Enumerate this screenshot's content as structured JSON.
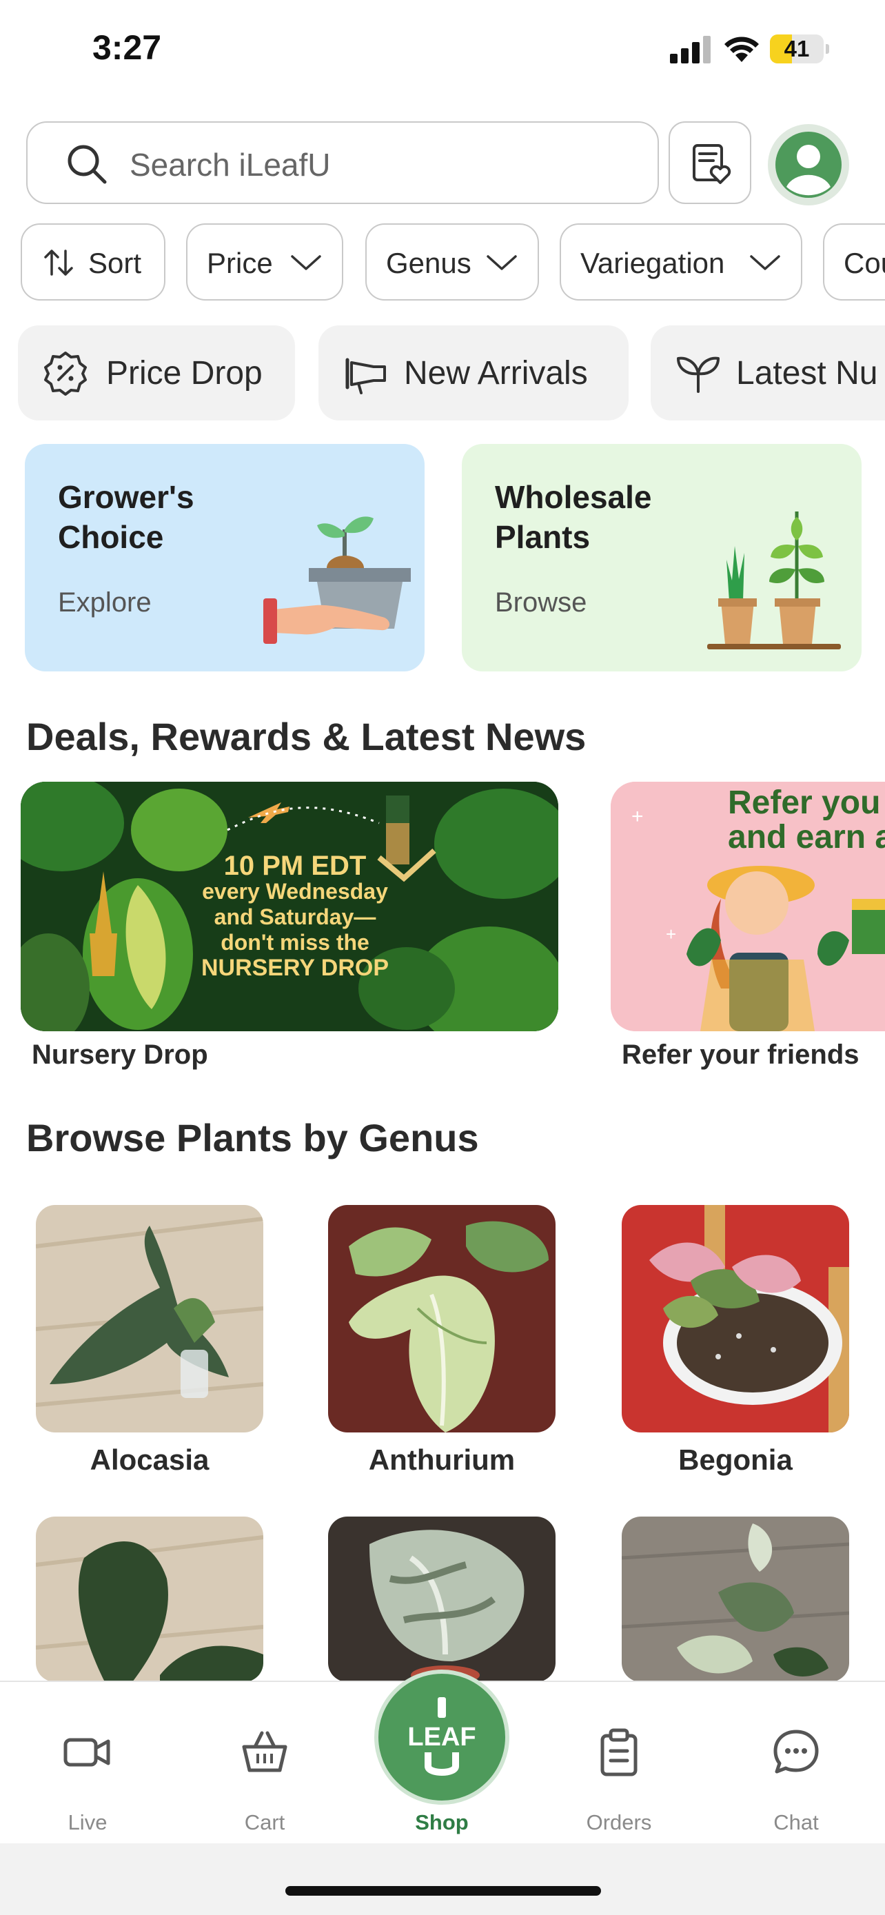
{
  "status_bar": {
    "time": "3:27",
    "battery_percent": 41
  },
  "search": {
    "placeholder": "Search iLeafU"
  },
  "filters": {
    "sort": "Sort",
    "price": "Price",
    "genus": "Genus",
    "variegation": "Variegation",
    "country": "Cou"
  },
  "quick_links": {
    "price_drop": "Price Drop",
    "new_arrivals": "New Arrivals",
    "latest_nurseries": "Latest Nu"
  },
  "categories": [
    {
      "title": "Grower's Choice",
      "action": "Explore",
      "bg": "#cfe9fb"
    },
    {
      "title": "Wholesale Plants",
      "action": "Browse",
      "bg": "#e6f7e1"
    }
  ],
  "sections": {
    "deals_title": "Deals, Rewards & Latest News",
    "genus_title": "Browse Plants by Genus"
  },
  "deals": [
    {
      "banner_lines": [
        "10 PM EDT",
        "every Wednesday",
        "and Saturday—",
        "don't miss the",
        "NURSERY DROP"
      ],
      "caption": "Nursery Drop"
    },
    {
      "banner_lines": [
        "Refer you",
        "and earn a"
      ],
      "caption": "Refer your friends"
    }
  ],
  "genera": [
    "Alocasia",
    "Anthurium",
    "Begonia"
  ],
  "tab_bar": {
    "live": "Live",
    "cart": "Cart",
    "shop": "Shop",
    "orders": "Orders",
    "chat": "Chat",
    "logo_text": "LEAF U"
  },
  "colors": {
    "brand_green": "#4e9a5b",
    "active_tab": "#2f7d45",
    "grower_bg": "#cfe9fb",
    "wholesale_bg": "#e6f7e1"
  }
}
